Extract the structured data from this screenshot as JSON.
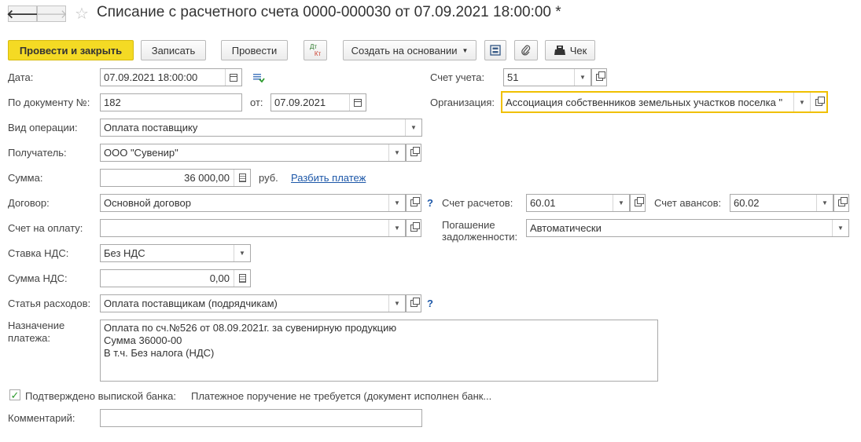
{
  "header": {
    "back_glyph": "🡐",
    "forward_glyph": "🡒",
    "star_glyph": "☆",
    "title": "Списание с расчетного счета 0000-000030 от 07.09.2021 18:00:00 *"
  },
  "toolbar": {
    "post_and_close": "Провести и закрыть",
    "save": "Записать",
    "post": "Провести",
    "dtkt_top": "Дт",
    "dtkt_bottom": "Кт",
    "create_based_on": "Создать на основании",
    "receipt": "Чек"
  },
  "form": {
    "date_label": "Дата:",
    "date_value": "07.09.2021 18:00:00",
    "doc_number_label": "По документу №:",
    "doc_number_value": "182",
    "from_label": "от:",
    "from_value": "07.09.2021",
    "operation_label": "Вид операции:",
    "operation_value": "Оплата поставщику",
    "recipient_label": "Получатель:",
    "recipient_value": "ООО \"Сувенир\"",
    "amount_label": "Сумма:",
    "amount_value": "36 000,00",
    "currency": "руб.",
    "split_payment": "Разбить платеж",
    "contract_label": "Договор:",
    "contract_value": "Основной договор",
    "invoice_label": "Счет на оплату:",
    "invoice_value": "",
    "vat_rate_label": "Ставка НДС:",
    "vat_rate_value": "Без НДС",
    "vat_amount_label": "Сумма НДС:",
    "vat_amount_value": "0,00",
    "expense_item_label": "Статья расходов:",
    "expense_item_value": "Оплата поставщикам (подрядчикам)",
    "purpose_label_line1": "Назначение",
    "purpose_label_line2": "платежа:",
    "purpose_lines": [
      "Оплата по сч.№526 от 08.09.2021г. за сувенирную продукцию",
      "Сумма 36000-00",
      "В т.ч. Без налога (НДС)"
    ],
    "confirmed_label": "Подтверждено выпиской банка:",
    "confirmed_checked": true,
    "confirmed_note": "Платежное поручение не требуется (документ исполнен банк...",
    "comment_label": "Комментарий:",
    "comment_value": "",
    "help_mark": "?",
    "account_label": "Счет учета:",
    "account_value": "51",
    "org_label": "Организация:",
    "org_value": "Ассоциация собственников земельных участков поселка \"",
    "settlement_account_label": "Счет расчетов:",
    "settlement_account_value": "60.01",
    "advance_account_label": "Счет авансов:",
    "advance_account_value": "60.02",
    "debt_repayment_label_line1": "Погашение",
    "debt_repayment_label_line2": "задолженности:",
    "debt_repayment_value": "Автоматически"
  },
  "colors": {
    "primary_button": "#f4da24",
    "link": "#1c57a8",
    "focus_border": "#f0c000",
    "check": "#2c9a2c"
  }
}
